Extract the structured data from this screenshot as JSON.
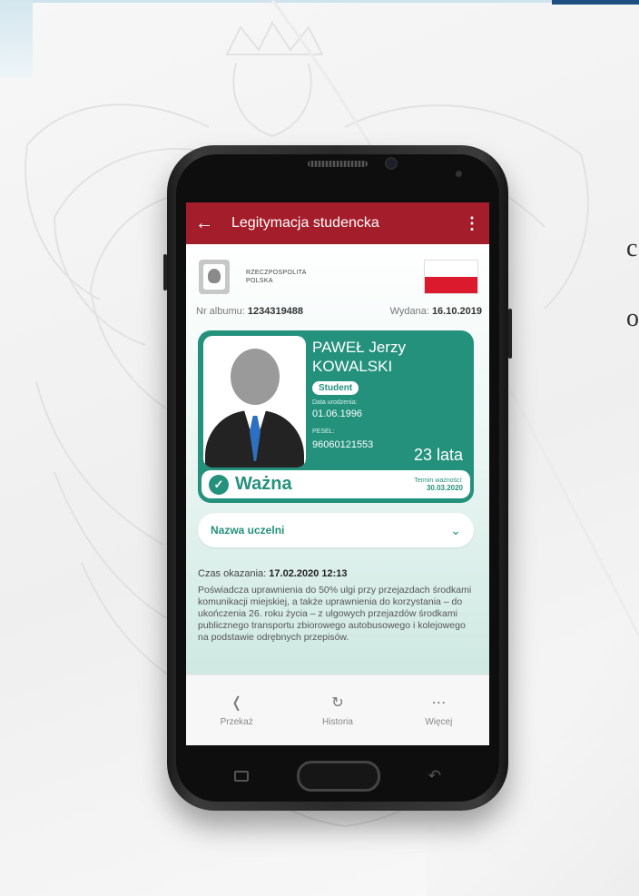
{
  "background": {
    "fragment_1": "c",
    "fragment_2": "o"
  },
  "app": {
    "title": "Legitymacja studencka",
    "back_icon": "arrow-left-icon",
    "menu_icon": "kebab-menu-icon"
  },
  "header": {
    "country_line1": "RZECZPOSPOLITA",
    "country_line2": "POLSKA"
  },
  "info": {
    "album_label": "Nr albumu:",
    "album_value": "1234319488",
    "issued_label": "Wydana:",
    "issued_value": "16.10.2019"
  },
  "card": {
    "name_line1": "PAWEŁ Jerzy",
    "name_line2": "KOWALSKI",
    "role_badge": "Student",
    "dob_label": "Data urodzenia:",
    "dob_value": "01.06.1996",
    "pesel_label": "PESEL:",
    "pesel_value": "96060121553",
    "age": "23 lata",
    "status": "Ważna",
    "expiry_label": "Termin ważności:",
    "expiry_value": "30.03.2020",
    "accent_color": "#24917c"
  },
  "university": {
    "label": "Nazwa uczelni"
  },
  "shown": {
    "label": "Czas okazania:",
    "value": "17.02.2020 12:13"
  },
  "description": "Poświadcza uprawnienia do 50% ulgi przy przejazdach środkami komunikacji miejskiej, a także uprawnienia do korzystania – do ukończenia 26. roku życia – z ulgowych przejazdów środkami publicznego transportu zbiorowego autobusowego i kolejowego na podstawie odrębnych przepisów.",
  "nav": [
    {
      "label": "Przekaż",
      "icon": "share-icon"
    },
    {
      "label": "Historia",
      "icon": "history-icon"
    },
    {
      "label": "Więcej",
      "icon": "more-icon"
    }
  ],
  "colors": {
    "app_bar": "#a41d2a",
    "flag_red": "#dc1a2e"
  }
}
